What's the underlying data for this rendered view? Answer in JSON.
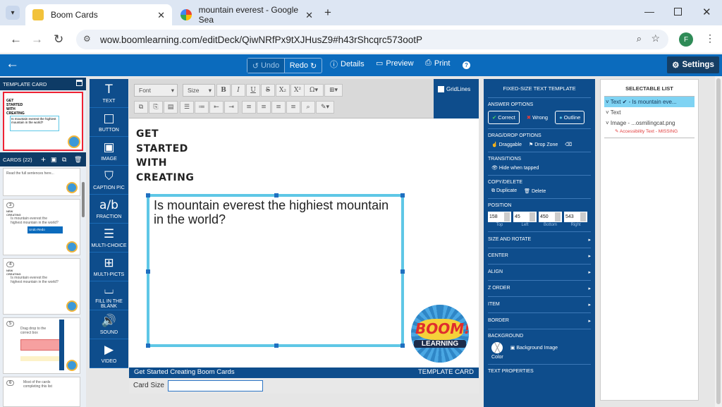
{
  "browser": {
    "tabs": [
      {
        "title": "Boom Cards",
        "active": true
      },
      {
        "title": "mountain everest - Google Sea",
        "active": false
      }
    ],
    "url": "wow.boomlearning.com/editDeck/QiwNRfPx9tXJHusZ9#h43rShcqrc573ootP",
    "profile_initial": "F"
  },
  "appbar": {
    "undo": "Undo",
    "redo": "Redo",
    "details": "Details",
    "preview": "Preview",
    "print": "Print",
    "help": "?",
    "settings": "Settings"
  },
  "left": {
    "template_header": "TEMPLATE CARD",
    "template_card_text": "GET STARTED WITH CREATING",
    "template_card_sub": "Is mountain everest the highiest mountain in the world?",
    "cards_header": "CARDS (22)",
    "thumbs": [
      {
        "num": "",
        "text": "Read the full sentences here...",
        "extra": ""
      },
      {
        "num": "3",
        "text": "Is mountain everest the highest mountain in the world?",
        "extra": "Undo  Redo"
      },
      {
        "num": "4",
        "text": "Is mountain everest the highest mountain in the world?",
        "extra": ""
      },
      {
        "num": "5",
        "text": "Drag drop to the correct box",
        "extra": ""
      },
      {
        "num": "6",
        "text": "Most of the cards completing this list",
        "extra": ""
      }
    ]
  },
  "tools": [
    {
      "icon": "T",
      "label": "TEXT",
      "name": "tool-text"
    },
    {
      "icon": "□",
      "label": "BUTTON",
      "name": "tool-button"
    },
    {
      "icon": "▣",
      "label": "IMAGE",
      "name": "tool-image"
    },
    {
      "icon": "⛉",
      "label": "CAPTION PIC",
      "name": "tool-caption-pic"
    },
    {
      "icon": "a/b",
      "label": "FRACTION",
      "name": "tool-fraction"
    },
    {
      "icon": "☰",
      "label": "MULTI-CHOICE",
      "name": "tool-multi-choice"
    },
    {
      "icon": "⊞",
      "label": "MULTI-PICTS",
      "name": "tool-multi-picts"
    },
    {
      "icon": "⌴",
      "label": "FILL IN THE BLANK",
      "name": "tool-fill-in-the-blank"
    },
    {
      "icon": "🔊",
      "label": "SOUND",
      "name": "tool-sound"
    },
    {
      "icon": "▶",
      "label": "VIDEO",
      "name": "tool-video"
    }
  ],
  "editor": {
    "font_select": "Font",
    "size_select": "Size",
    "gridlines": "GridLines",
    "card_title": [
      "GET",
      "STARTED",
      "WITH",
      "CREATING"
    ],
    "question": "Is mountain everest the highiest mountain in the world?",
    "logo_top": "BOOM!",
    "logo_bottom": "LEARNING",
    "footer_left": "Get Started Creating Boom Cards",
    "footer_right": "TEMPLATE CARD",
    "card_size_label": "Card Size"
  },
  "panel": {
    "title": "FIXED-SIZE TEXT TEMPLATE",
    "answer_options": "ANSWER OPTIONS",
    "correct": "Correct",
    "wrong": "Wrong",
    "outline": "Outline",
    "dragdrop": "DRAG/DROP OPTIONS",
    "draggable": "Draggable",
    "dropzone": "Drop Zone",
    "transitions": "TRANSITIONS",
    "hide_when_tapped": "Hide when tapped",
    "copydelete": "COPY/DELETE",
    "duplicate": "Duplicate",
    "delete": "Delete",
    "position": "POSITION",
    "pos_values": [
      "158",
      "45",
      "450",
      "543"
    ],
    "pos_labels": [
      "Top",
      "Left",
      "Bottom",
      "Right"
    ],
    "collapsibles": [
      "SIZE AND ROTATE",
      "CENTER",
      "ALIGN",
      "Z ORDER",
      "ITEM",
      "BORDER"
    ],
    "background": "BACKGROUND",
    "color": "Color",
    "background_image": "Background Image",
    "text_properties": "TEXT PROPERTIES"
  },
  "selectable": {
    "header": "SELECTABLE LIST",
    "items": [
      "Text ✔ - Is mountain eve...",
      "Text",
      "Image - ...osmilingcat.png"
    ],
    "missing": "Accessibility Text - MISSING"
  },
  "colors": {
    "appbar": "#0b6bbd",
    "dark_blue": "#0e4d8c",
    "highlight": "#7fd3f3",
    "error": "#e03c3c"
  }
}
